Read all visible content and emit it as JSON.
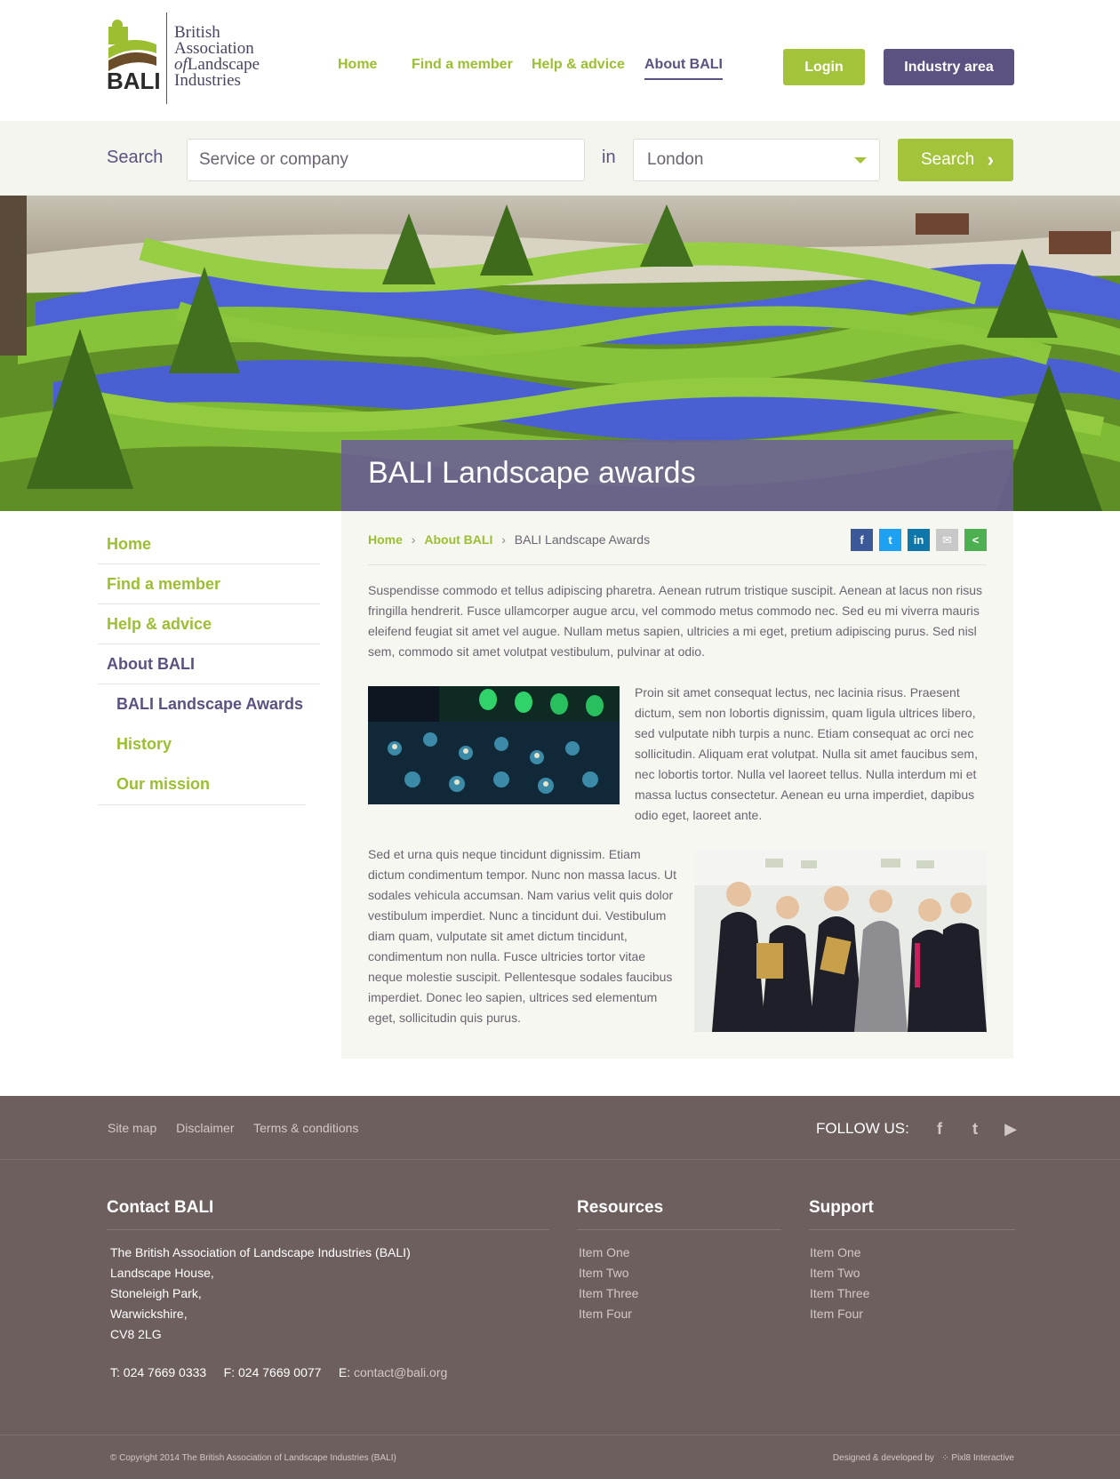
{
  "logo": {
    "bali": "BALI",
    "line1": "British",
    "line2": "Association",
    "line3_of": "of",
    "line3": "Landscape",
    "line4": "Industries"
  },
  "nav": {
    "items": [
      {
        "label": "Home"
      },
      {
        "label": "Find a member"
      },
      {
        "label": "Help & advice"
      },
      {
        "label": "About BALI"
      }
    ],
    "login": "Login",
    "industry": "Industry area"
  },
  "search": {
    "label": "Search",
    "placeholder": "Service or company",
    "in_label": "in",
    "location": "London",
    "button": "Search"
  },
  "hero": {
    "title": "BALI Landscape awards"
  },
  "sidebar": {
    "items": [
      {
        "label": "Home"
      },
      {
        "label": "Find a member"
      },
      {
        "label": "Help & advice"
      },
      {
        "label": "About BALI"
      }
    ],
    "sub_items": [
      {
        "label": "BALI Landscape Awards"
      },
      {
        "label": "History"
      },
      {
        "label": "Our mission"
      }
    ]
  },
  "breadcrumb": {
    "home": "Home",
    "about": "About BALI",
    "current": "BALI Landscape Awards",
    "separator": "›"
  },
  "share": {
    "icons": [
      "facebook-icon",
      "twitter-icon",
      "linkedin-icon",
      "email-icon",
      "share-icon"
    ],
    "colors": [
      "#3b5998",
      "#1da1f2",
      "#0e76a8",
      "#c8c8c8",
      "#4caf50"
    ]
  },
  "content": {
    "p1": "Suspendisse commodo et tellus adipiscing pharetra. Aenean rutrum tristique suscipit. Aenean at lacus non risus fringilla hendrerit. Fusce ullamcorper augue arcu, vel commodo metus commodo nec. Sed eu mi viverra mauris eleifend feugiat sit amet vel augue. Nullam metus sapien, ultricies a mi eget, pretium adipiscing purus. Sed nisl sem, commodo sit amet volutpat vestibulum, pulvinar at odio.",
    "p2": "Proin sit amet consequat lectus, nec lacinia risus. Praesent dictum, sem non lobortis dignissim, quam ligula ultrices libero, sed vulputate nibh turpis a nunc. Etiam consequat ac orci nec sollicitudin. Aliquam erat volutpat. Nulla sit amet faucibus sem, nec lobortis tortor. Nulla vel laoreet tellus. Nulla interdum mi et massa luctus consectetur. Aenean eu urna imperdiet, dapibus odio eget, laoreet ante.",
    "p3": "Sed et urna quis neque tincidunt dignissim. Etiam dictum condimentum tempor. Nunc non massa lacus. Ut sodales vehicula accumsan. Nam varius velit quis dolor vestibulum imperdiet. Nunc a tincidunt dui. Vestibulum diam quam, vulputate sit amet dictum tincidunt, condimentum non nulla. Fusce ultricies tortor vitae neque molestie suscipit. Pellentesque sodales faucibus imperdiet. Donec leo sapien, ultrices sed elementum eget, sollicitudin quis purus."
  },
  "footer": {
    "links": [
      "Site map",
      "Disclaimer",
      "Terms & conditions"
    ],
    "follow": "FOLLOW US:",
    "socials": [
      "facebook-icon",
      "twitter-icon",
      "youtube-icon"
    ],
    "contact_title": "Contact BALI",
    "address": [
      "The British Association of Landscape Industries (BALI)",
      "Landscape House,",
      "Stoneleigh Park,",
      "Warwickshire,",
      "CV8 2LG"
    ],
    "phone": "T: 024 7669 0333",
    "fax": "F: 024 7669 0077",
    "email_label": "E:",
    "email": "contact@bali.org",
    "resources_title": "Resources",
    "resources": [
      "Item One",
      "Item Two",
      "Item Three",
      "Item Four"
    ],
    "support_title": "Support",
    "support": [
      "Item One",
      "Item Two",
      "Item Three",
      "Item Four"
    ],
    "copyright": "© Copyright 2014 The British Association of Landscape Industries (BALI)",
    "credit_prefix": "Designed & developed by",
    "credit_name": "Pixl8 Interactive"
  }
}
